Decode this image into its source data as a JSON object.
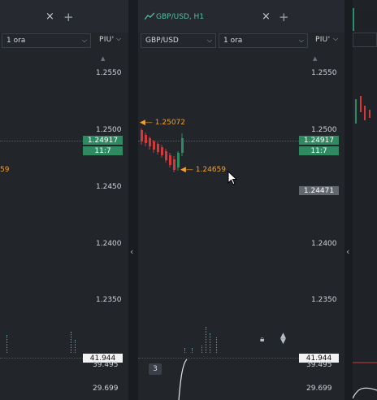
{
  "left_panel": {
    "timeframe": "1 ora",
    "scale_label": "PIU'",
    "price_ticks": [
      "1.2550",
      "1.2500",
      "1.2450",
      "1.2400",
      "1.2350"
    ],
    "current_price": "1.24917",
    "countdown": "11:7",
    "low_label_partial": "59",
    "volume_tag": "41.944",
    "sub_ticks": [
      "39.495",
      "29.699"
    ]
  },
  "mid_panel": {
    "tab_title": "GBP/USD, H1",
    "symbol": "GBP/USD",
    "timeframe": "1 ora",
    "scale_label": "PIU'",
    "price_ticks": [
      "1.2550",
      "1.2500",
      "1.2450",
      "1.2400",
      "1.2350"
    ],
    "high_label": "1.25072",
    "low_label": "1.24659",
    "current_price": "1.24917",
    "countdown": "11:7",
    "crosshair_price": "1.24471",
    "volume_tag": "41.944",
    "sub_ticks": [
      "39.495",
      "29.699"
    ],
    "badge": "3"
  },
  "icons": {
    "close": "×",
    "add": "+",
    "chevron": "⌵",
    "collapse": "‹"
  },
  "colors": {
    "accent": "#4ec2a0",
    "up": "#2f8a62",
    "down": "#d23a3a",
    "annotation": "#f0a030"
  }
}
